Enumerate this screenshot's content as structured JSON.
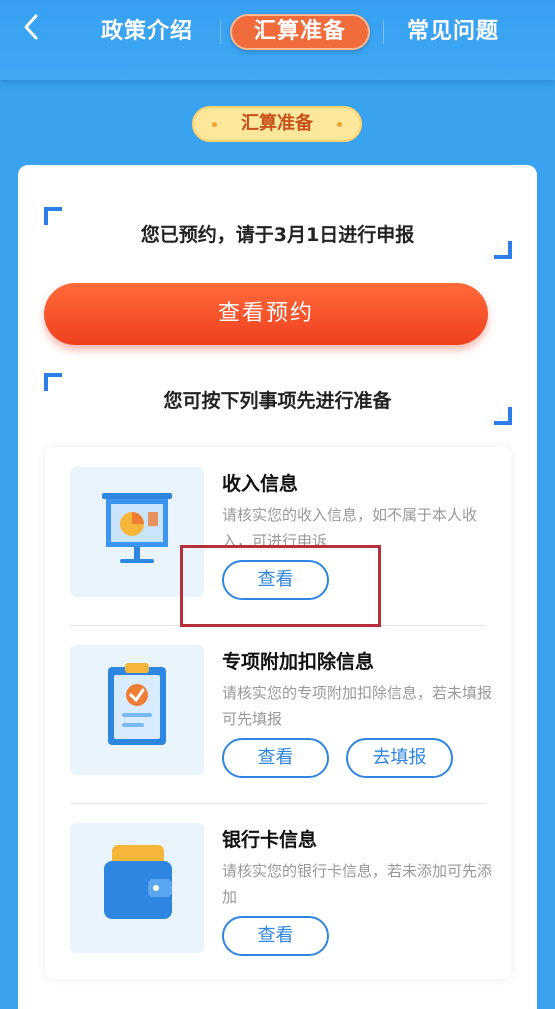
{
  "header": {
    "tabs": [
      {
        "label": "政策介绍",
        "active": false
      },
      {
        "label": "汇算准备",
        "active": true
      },
      {
        "label": "常见问题",
        "active": false
      }
    ],
    "back_icon": "chevron-left-icon"
  },
  "section_badge": "汇算准备",
  "card": {
    "reservation_notice": "您已预约，请于3月1日进行申报",
    "view_reservation_button": "查看预约",
    "prepare_notice": "您可按下列事项先进行准备"
  },
  "items": [
    {
      "title": "收入信息",
      "desc": "请核实您的收入信息，如不属于本人收入，可进行申诉",
      "icon": "presentation-chart-icon",
      "buttons": [
        "查看"
      ]
    },
    {
      "title": "专项附加扣除信息",
      "desc": "请核实您的专项附加扣除信息，若未填报可先填报",
      "icon": "clipboard-check-icon",
      "buttons": [
        "查看",
        "去填报"
      ]
    },
    {
      "title": "银行卡信息",
      "desc": "请核实您的银行卡信息，若未添加可先添加",
      "icon": "wallet-icon",
      "buttons": [
        "查看"
      ]
    }
  ],
  "colors": {
    "background": "#3aa3f0",
    "active_tab": "#f26b3d",
    "primary_button": "#f0401f",
    "link_blue": "#2f86e0",
    "highlight_box": "#b6303c"
  }
}
